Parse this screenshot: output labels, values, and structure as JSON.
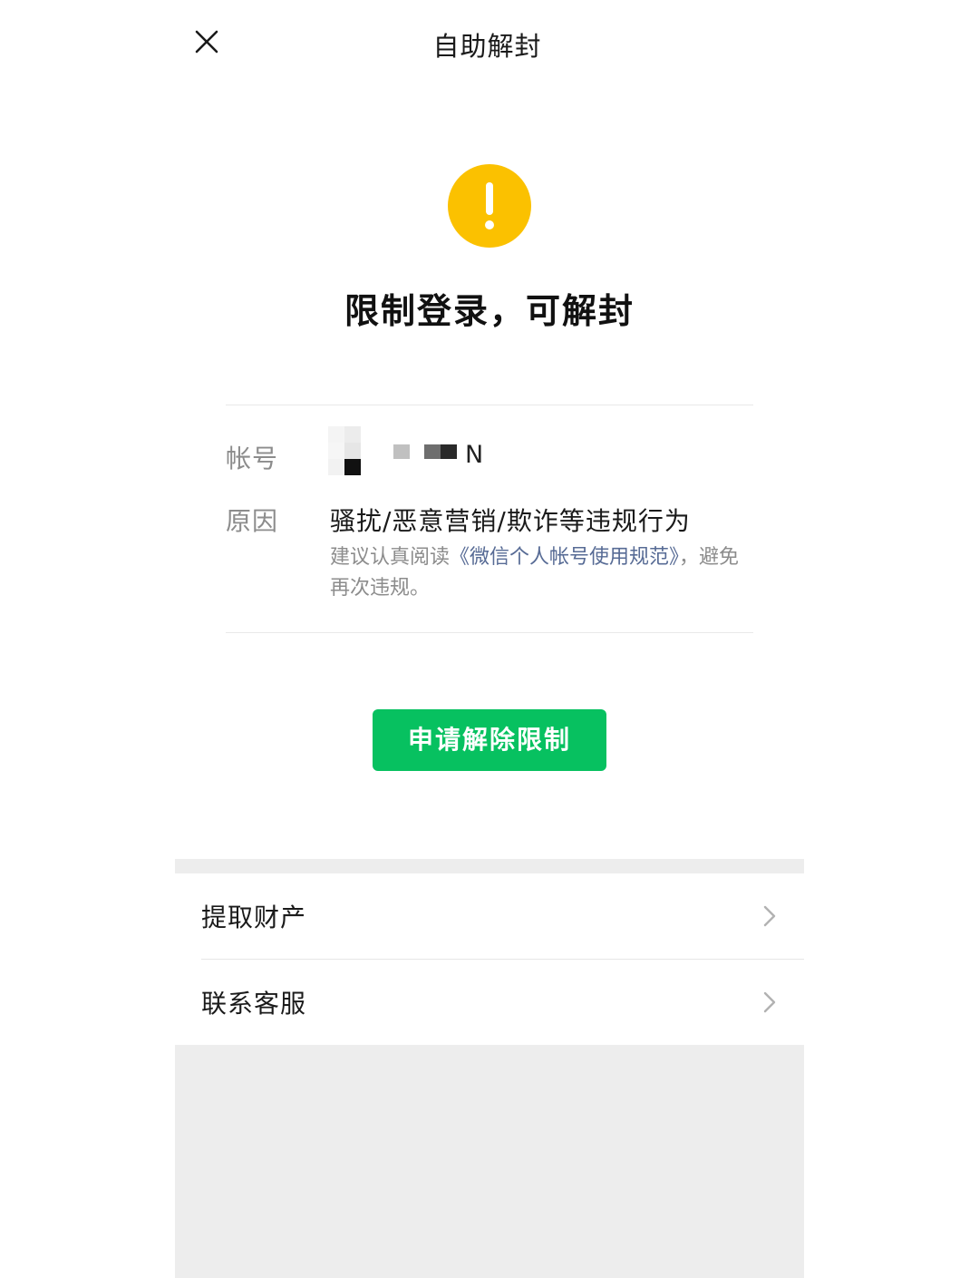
{
  "header": {
    "title": "自助解封",
    "close_icon": "close-icon"
  },
  "status": {
    "icon": "warning-icon",
    "icon_color": "#fbc100",
    "title": "限制登录，可解封"
  },
  "info": {
    "account_label": "帐号",
    "account_suffix": "N",
    "reason_label": "原因",
    "reason_value": "骚扰/恶意营销/欺诈等违规行为",
    "hint_prefix": "建议认真阅读",
    "hint_link": "《微信个人帐号使用规范》",
    "hint_suffix": "，避免再次违规。",
    "link_color": "#576b95"
  },
  "action": {
    "apply_label": "申请解除限制",
    "button_color": "#07c160"
  },
  "list": {
    "items": [
      {
        "label": "提取财产",
        "icon": "chevron-right-icon"
      },
      {
        "label": "联系客服",
        "icon": "chevron-right-icon"
      }
    ]
  }
}
